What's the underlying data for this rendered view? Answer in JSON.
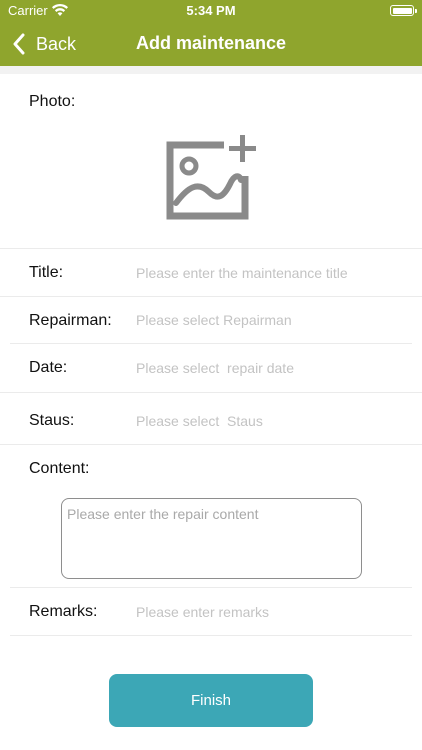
{
  "status_bar": {
    "carrier": "Carrier",
    "time": "5:34 PM",
    "wifi_icon": "wifi-icon",
    "battery_icon": "battery-icon"
  },
  "nav": {
    "back_label": "Back",
    "back_icon": "chevron-left-icon",
    "title": "Add maintenance",
    "bar_color": "#8fa52d"
  },
  "form": {
    "photo": {
      "label": "Photo:",
      "icon": "add-image-icon"
    },
    "title": {
      "label": "Title:",
      "placeholder": "Please enter the maintenance title"
    },
    "repairman": {
      "label": "Repairman:",
      "placeholder": "Please select Repairman"
    },
    "date": {
      "label": "Date:",
      "placeholder": "Please select  repair date"
    },
    "status": {
      "label": "Staus:",
      "placeholder": "Please select  Staus"
    },
    "content": {
      "label": "Content:",
      "placeholder": "Please enter the repair content"
    },
    "remarks": {
      "label": "Remarks:",
      "placeholder": "Please enter remarks"
    }
  },
  "finish": {
    "label": "Finish",
    "color": "#3ca7b6"
  }
}
